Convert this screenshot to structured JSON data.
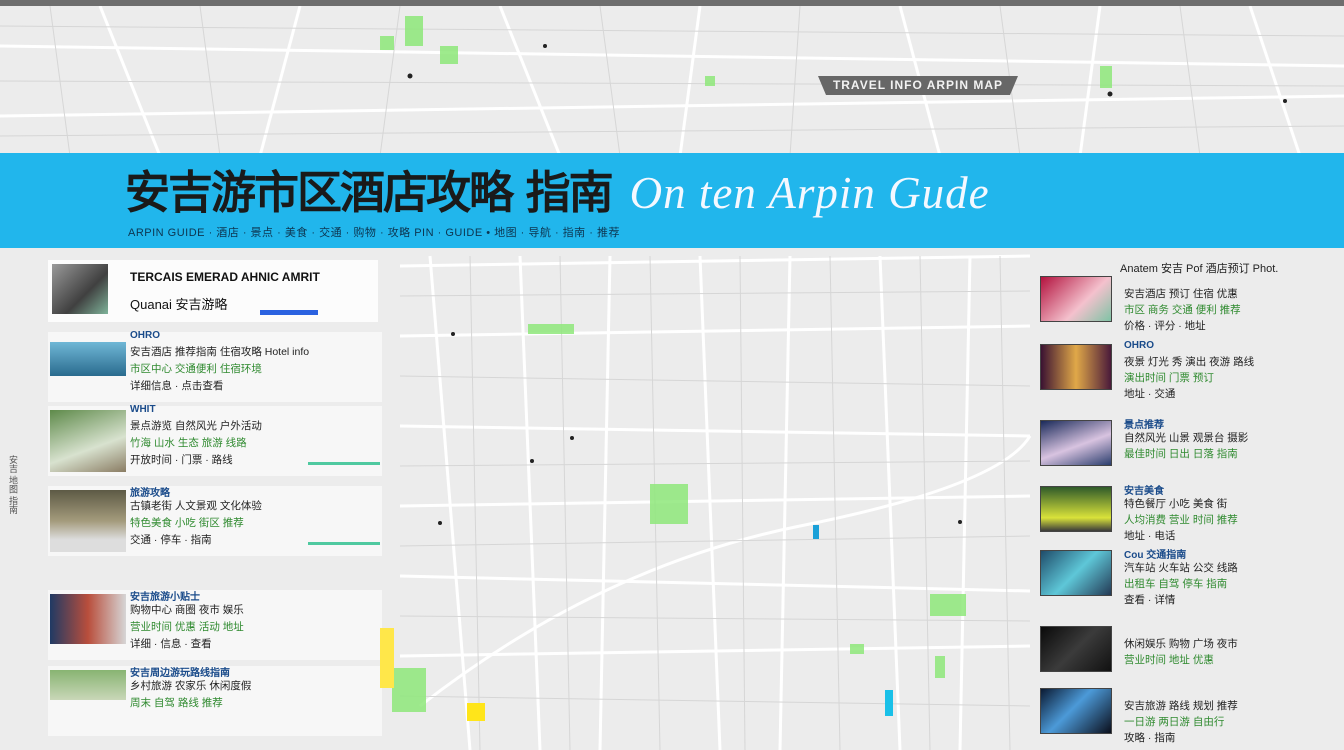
{
  "top_badge": "TRAVEL INFO  ARPIN MAP",
  "banner": {
    "title_cjk": "安吉游市区酒店攻略 指南",
    "title_latin": "On ten  Arpin Gude",
    "subtitle": "ARPIN GUIDE · 酒店 · 景点 · 美食 · 交通 · 购物 · 攻略 PIN · GUIDE • 地图 · 导航 · 指南 · 推荐"
  },
  "left_panel": {
    "header": {
      "title": "TERCAIS EMERAD AHNIC AMRIT",
      "subtitle": "Quanai 安吉游略"
    },
    "items": [
      {
        "category": "OHRO",
        "line1": "安吉酒店 推荐指南 住宿攻略 Hotel info",
        "line2": "市区中心 交通便利 住宿环境",
        "line3": "详细信息 · 点击查看"
      },
      {
        "category": "WHIT",
        "line1": "景点游览 自然风光 户外活动",
        "line2": "竹海 山水 生态 旅游 线路",
        "line3": "开放时间 · 门票 · 路线"
      },
      {
        "category": "旅游攻略",
        "line1": "古镇老街 人文景观 文化体验",
        "line2": "特色美食 小吃 街区 推荐",
        "line3": "交通 · 停车 · 指南"
      },
      {
        "category": "安吉旅游小贴士",
        "line1": "购物中心 商圈 夜市 娱乐",
        "line2": "营业时间 优惠 活动 地址",
        "line3": "详细 · 信息 · 查看"
      },
      {
        "category": "安吉周边游玩路线指南",
        "line1": "乡村旅游 农家乐 休闲度假",
        "line2": "周末 自驾 路线 推荐",
        "line3": ""
      }
    ]
  },
  "right_panel": {
    "header_line": "Anatem 安吉 Pof 酒店预订 Phot.",
    "items": [
      {
        "category": "",
        "line1": "安吉酒店 预订 住宿 优惠",
        "line2": "市区 商务 交通 便利 推荐",
        "line3": "价格 · 评分 · 地址"
      },
      {
        "category": "OHRO",
        "line1": "夜景 灯光 秀 演出 夜游 路线",
        "line2": "演出时间 门票 预订",
        "line3": "地址 · 交通"
      },
      {
        "category": "景点推荐",
        "line1": "自然风光 山景 观景台 摄影",
        "line2": "最佳时间 日出 日落 指南",
        "line3": ""
      },
      {
        "category": "安吉美食",
        "line1": "特色餐厅 小吃 美食 街",
        "line2": "人均消费 营业 时间 推荐",
        "line3": "地址 · 电话"
      },
      {
        "category": "Cou 交通指南",
        "line1": "汽车站 火车站 公交 线路",
        "line2": "出租车 自驾 停车 指南",
        "line3": "查看 · 详情"
      },
      {
        "category": "",
        "line1": "休闲娱乐 购物 广场 夜市",
        "line2": "营业时间 地址 优惠",
        "line3": ""
      },
      {
        "category": "",
        "line1": "安吉旅游 路线 规划 推荐",
        "line2": "一日游 两日游 自由行",
        "line3": "攻略 · 指南"
      }
    ]
  },
  "side_text": "安吉 地图 指南",
  "colors": {
    "banner": "#21b6ec",
    "map_bg": "#ececec",
    "road": "#ffffff",
    "park": "#8ee87a"
  }
}
